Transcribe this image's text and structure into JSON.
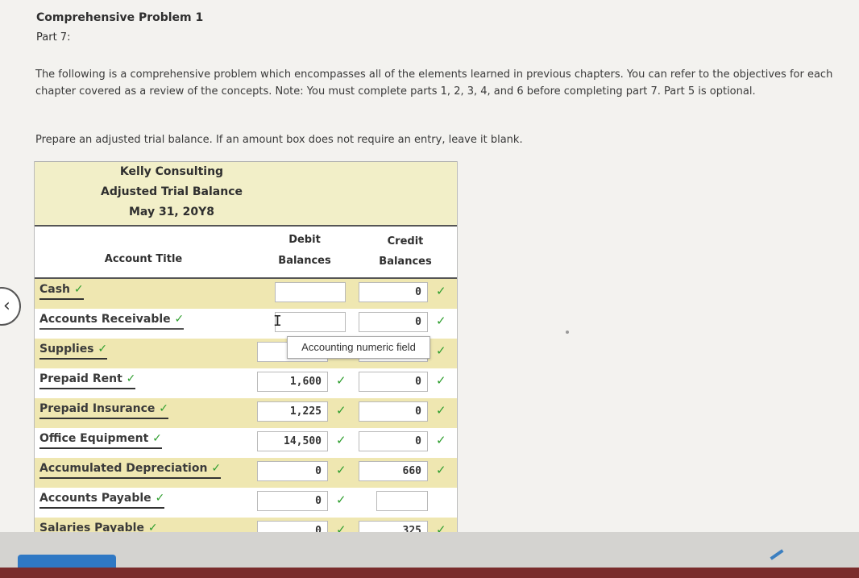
{
  "header": {
    "title": "Comprehensive Problem 1",
    "part": "Part 7:"
  },
  "intro_text": "The following is a comprehensive problem which encompasses all of the elements learned in previous chapters. You can refer to the objectives for each chapter covered as a review of the concepts. Note: You must complete parts 1, 2, 3, 4, and 6 before completing part 7. Part 5 is optional.",
  "instruction": "Prepare an adjusted trial balance. If an amount box does not require an entry, leave it blank.",
  "table": {
    "company": "Kelly Consulting",
    "statement": "Adjusted Trial Balance",
    "date": "May 31, 20Y8",
    "col_account": "Account Title",
    "col_debit_1": "Debit",
    "col_debit_2": "Balances",
    "col_credit_1": "Credit",
    "col_credit_2": "Balances",
    "check_mark": "✓",
    "rows": [
      {
        "account": "Cash",
        "debit": "",
        "credit": "0"
      },
      {
        "account": "Accounts Receivable",
        "debit": "",
        "credit": "0"
      },
      {
        "account": "Supplies",
        "debit": "",
        "credit": ""
      },
      {
        "account": "Prepaid Rent",
        "debit": "1,600",
        "credit": "0"
      },
      {
        "account": "Prepaid Insurance",
        "debit": "1,225",
        "credit": "0"
      },
      {
        "account": "Office Equipment",
        "debit": "14,500",
        "credit": "0"
      },
      {
        "account": "Accumulated Depreciation",
        "debit": "0",
        "credit": "660"
      },
      {
        "account": "Accounts Payable",
        "debit": "0",
        "credit": ""
      },
      {
        "account": "Salaries Payable",
        "debit": "0",
        "credit": "325"
      }
    ]
  },
  "tooltip": "Accounting numeric field",
  "colors": {
    "row_highlight": "#efe7b1",
    "header_bg": "#f2efc8",
    "check_green": "#2e9e2e",
    "button_blue": "#2f78c4"
  }
}
